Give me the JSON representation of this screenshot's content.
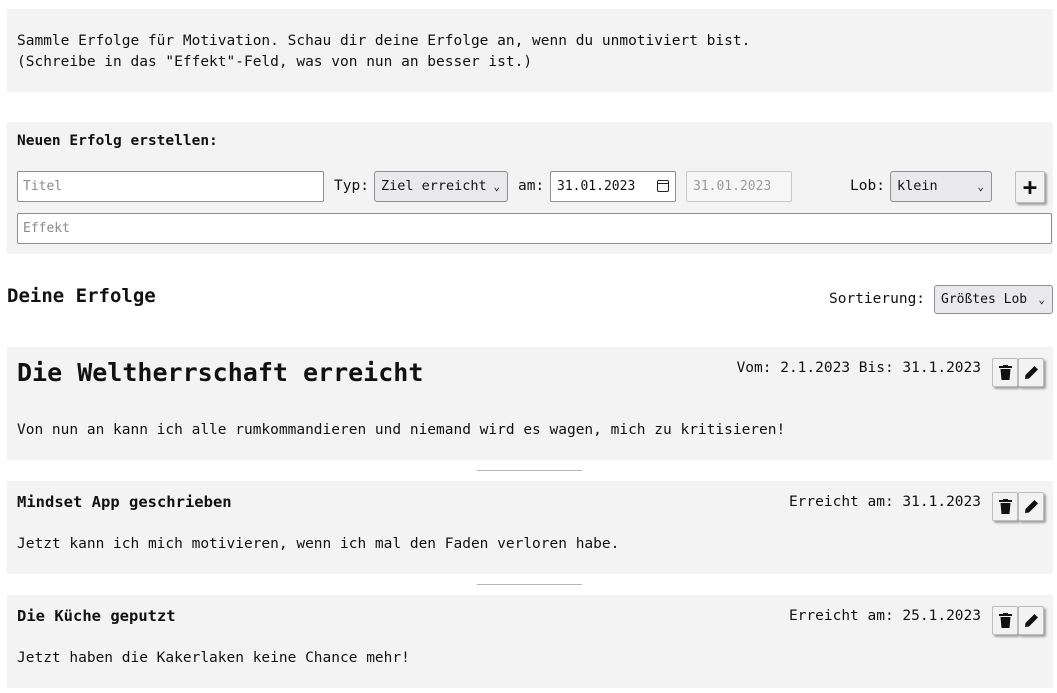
{
  "intro": {
    "line1": "Sammle Erfolge für Motivation. Schau dir deine Erfolge an, wenn du unmotiviert bist.",
    "line2": "(Schreibe in das \"Effekt\"-Feld, was von nun an besser ist.)"
  },
  "create": {
    "title": "Neuen Erfolg erstellen:",
    "title_placeholder": "Titel",
    "type_label": "Typ:",
    "type_value": "Ziel erreicht",
    "date_label": "am:",
    "date_value": "31.01.2023",
    "date_end_value": "31.01.2023",
    "praise_label": "Lob:",
    "praise_value": "klein",
    "add_label": "+",
    "effect_placeholder": "Effekt"
  },
  "list": {
    "heading": "Deine Erfolge",
    "sort_label": "Sortierung:",
    "sort_value": "Größtes Lob"
  },
  "achievements": [
    {
      "title": "Die Weltherrschaft erreicht",
      "date": "Vom: 2.1.2023 Bis: 31.1.2023",
      "effect": "Von nun an kann ich alle rumkommandieren und niemand wird es wagen, mich zu kritisieren!"
    },
    {
      "title": "Mindset App geschrieben",
      "date": "Erreicht am: 31.1.2023",
      "effect": "Jetzt kann ich mich motivieren, wenn ich mal den Faden verloren habe."
    },
    {
      "title": "Die Küche geputzt",
      "date": "Erreicht am: 25.1.2023",
      "effect": "Jetzt haben die Kakerlaken keine Chance mehr!"
    }
  ],
  "icons": {
    "delete": "trash-icon",
    "edit": "pencil-icon",
    "dropdown": "chevron-down-icon",
    "calendar": "calendar-icon"
  }
}
